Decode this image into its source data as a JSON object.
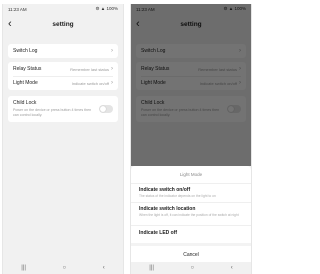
{
  "status_bar": {
    "time": "11:23 AM",
    "icons": "⚙ ▲ 100%"
  },
  "header": {
    "back_icon": "chevron-left-icon",
    "back_glyph": "‹",
    "title": "setting"
  },
  "settings": {
    "switch_log": {
      "label": "Switch Log"
    },
    "relay_status": {
      "label": "Relay Status",
      "value": "Remember last status"
    },
    "light_mode": {
      "label": "Light Mode",
      "value": "Indicate switch on/off"
    },
    "child_lock": {
      "label": "Child Lock",
      "description": "Power on the device or press button 4 times then can control locally.",
      "enabled": false
    }
  },
  "sheet": {
    "title": "Light Mode",
    "options": [
      {
        "title": "Indicate switch on/off",
        "desc": "The status of the indicator depends on the light to on"
      },
      {
        "title": "Indicate switch location",
        "desc": "When the light is off, it can indicate the position of the switch at night"
      },
      {
        "title": "Indicate LED off",
        "desc": ""
      }
    ],
    "cancel": "Cancel"
  },
  "system_nav": {
    "recents": "|||",
    "home": "○",
    "back": "‹"
  }
}
